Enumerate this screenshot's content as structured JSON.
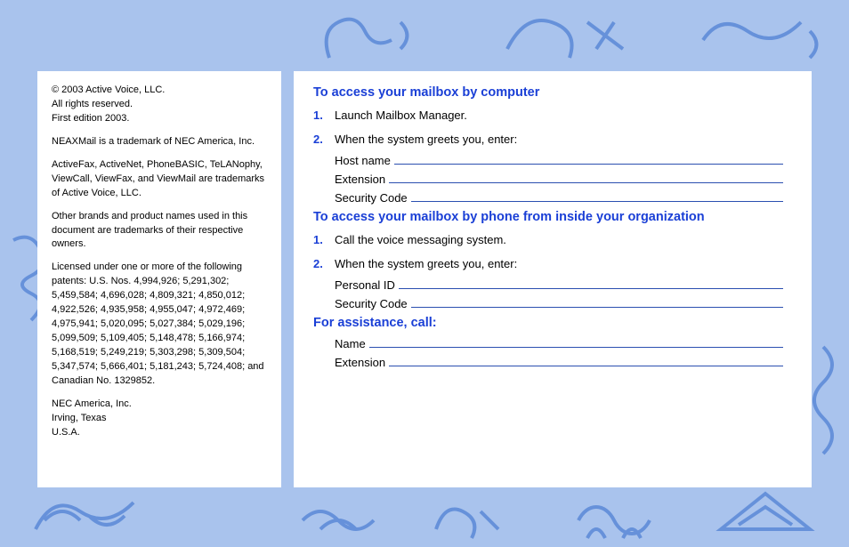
{
  "left": {
    "p1": "© 2003 Active Voice, LLC.\nAll rights reserved.\nFirst edition 2003.",
    "p2": "NEAXMail is a trademark of NEC America, Inc.",
    "p3": "ActiveFax, ActiveNet, PhoneBASIC, TeLANophy, ViewCall, ViewFax, and ViewMail are trademarks of Active Voice, LLC.",
    "p4": "Other brands and product names used in this document are trademarks of their respective owners.",
    "p5": "Licensed under one or more of the following patents: U.S. Nos. 4,994,926; 5,291,302; 5,459,584; 4,696,028; 4,809,321; 4,850,012; 4,922,526; 4,935,958; 4,955,047; 4,972,469; 4,975,941; 5,020,095; 5,027,384; 5,029,196; 5,099,509; 5,109,405; 5,148,478; 5,166,974; 5,168,519; 5,249,219; 5,303,298; 5,309,504; 5,347,574; 5,666,401; 5,181,243; 5,724,408; and Canadian No. 1329852.",
    "p6": "NEC America, Inc.\nIrving, Texas\nU.S.A."
  },
  "right": {
    "heading1": "To access your mailbox by computer",
    "step1_1_num": "1.",
    "step1_1_text": "Launch Mailbox Manager.",
    "step1_2_num": "2.",
    "step1_2_text": "When the system greets you, enter:",
    "field_host": "Host name",
    "field_ext1": "Extension",
    "field_sec1": "Security Code",
    "heading2": "To access your mailbox by phone from inside your organization",
    "step2_1_num": "1.",
    "step2_1_text": "Call the voice messaging system.",
    "step2_2_num": "2.",
    "step2_2_text": "When the system greets you, enter:",
    "field_pid": "Personal ID",
    "field_sec2": "Security Code",
    "heading3": "For assistance, call:",
    "field_name": "Name",
    "field_ext2": "Extension"
  }
}
